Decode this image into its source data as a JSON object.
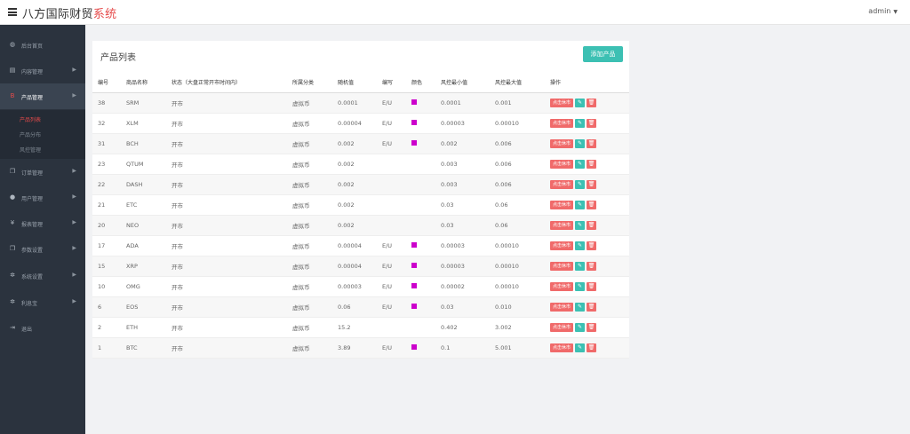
{
  "header": {
    "brand_main": "八方国际财贸",
    "brand_highlight": "系统",
    "user": "admin",
    "menu_icon": "hamburger-icon",
    "caret_icon": "caret-down-icon"
  },
  "sidebar": {
    "items": [
      {
        "label": "后台首页",
        "icon": "dashboard-icon",
        "glyph": "◍",
        "has_arrow": false
      },
      {
        "label": "内容管理",
        "icon": "book-icon",
        "glyph": "▤",
        "has_arrow": true
      },
      {
        "label": "产品管理",
        "icon": "bitcoin-icon",
        "glyph": "B",
        "has_arrow": true,
        "active": true
      },
      {
        "label": "订单管理",
        "icon": "copy-icon",
        "glyph": "❐",
        "has_arrow": true
      },
      {
        "label": "用户管理",
        "icon": "user-icon",
        "glyph": "●",
        "has_arrow": true
      },
      {
        "label": "报表管理",
        "icon": "yen-icon",
        "glyph": "¥",
        "has_arrow": true
      },
      {
        "label": "参数设置",
        "icon": "files-icon",
        "glyph": "❐",
        "has_arrow": true
      },
      {
        "label": "系统设置",
        "icon": "cogs-icon",
        "glyph": "✲",
        "has_arrow": true
      },
      {
        "label": "利息宝",
        "icon": "cogs-icon",
        "glyph": "✲",
        "has_arrow": true
      },
      {
        "label": "退出",
        "icon": "sign-out-icon",
        "glyph": "⇥",
        "has_arrow": false
      }
    ],
    "subitems": [
      {
        "label": "产品列表",
        "active": true
      },
      {
        "label": "产品分布",
        "active": false
      },
      {
        "label": "风控管理",
        "active": false
      }
    ]
  },
  "panel": {
    "title": "产品列表",
    "add_button": "添加产品"
  },
  "table": {
    "headers": [
      "编号",
      "商品名称",
      "状态（大盘正常开市时间内）",
      "所属分类",
      "随机值",
      "编写",
      "颜色",
      "风控最小值",
      "风控最大值",
      "操作"
    ],
    "action_on": "点击休市",
    "rows": [
      {
        "id": "38",
        "name": "SRM",
        "status": "开市",
        "category": "虚拟币",
        "random": "0.0001",
        "code": "E/U",
        "color": true,
        "min": "0.0001",
        "max": "0.001"
      },
      {
        "id": "32",
        "name": "XLM",
        "status": "开市",
        "category": "虚拟币",
        "random": "0.00004",
        "code": "E/U",
        "color": true,
        "min": "0.00003",
        "max": "0.00010"
      },
      {
        "id": "31",
        "name": "BCH",
        "status": "开市",
        "category": "虚拟币",
        "random": "0.002",
        "code": "E/U",
        "color": true,
        "min": "0.002",
        "max": "0.006"
      },
      {
        "id": "23",
        "name": "QTUM",
        "status": "开市",
        "category": "虚拟币",
        "random": "0.002",
        "code": "",
        "color": false,
        "min": "0.003",
        "max": "0.006"
      },
      {
        "id": "22",
        "name": "DASH",
        "status": "开市",
        "category": "虚拟币",
        "random": "0.002",
        "code": "",
        "color": false,
        "min": "0.003",
        "max": "0.006"
      },
      {
        "id": "21",
        "name": "ETC",
        "status": "开市",
        "category": "虚拟币",
        "random": "0.002",
        "code": "",
        "color": false,
        "min": "0.03",
        "max": "0.06"
      },
      {
        "id": "20",
        "name": "NEO",
        "status": "开市",
        "category": "虚拟币",
        "random": "0.002",
        "code": "",
        "color": false,
        "min": "0.03",
        "max": "0.06"
      },
      {
        "id": "17",
        "name": "ADA",
        "status": "开市",
        "category": "虚拟币",
        "random": "0.00004",
        "code": "E/U",
        "color": true,
        "min": "0.00003",
        "max": "0.00010"
      },
      {
        "id": "15",
        "name": "XRP",
        "status": "开市",
        "category": "虚拟币",
        "random": "0.00004",
        "code": "E/U",
        "color": true,
        "min": "0.00003",
        "max": "0.00010"
      },
      {
        "id": "10",
        "name": "OMG",
        "status": "开市",
        "category": "虚拟币",
        "random": "0.00003",
        "code": "E/U",
        "color": true,
        "min": "0.00002",
        "max": "0.00010"
      },
      {
        "id": "6",
        "name": "EOS",
        "status": "开市",
        "category": "虚拟币",
        "random": "0.06",
        "code": "E/U",
        "color": true,
        "min": "0.03",
        "max": "0.010"
      },
      {
        "id": "2",
        "name": "ETH",
        "status": "开市",
        "category": "虚拟币",
        "random": "15.2",
        "code": "",
        "color": false,
        "min": "0.402",
        "max": "3.002"
      },
      {
        "id": "1",
        "name": "BTC",
        "status": "开市",
        "category": "虚拟币",
        "random": "3.89",
        "code": "E/U",
        "color": true,
        "min": "0.1",
        "max": "5.001"
      }
    ]
  },
  "colors": {
    "swatch": "#cc00cc",
    "accent_red": "#e64a4a",
    "teal": "#3cc0b3",
    "sidebar_bg": "#2b333e"
  }
}
